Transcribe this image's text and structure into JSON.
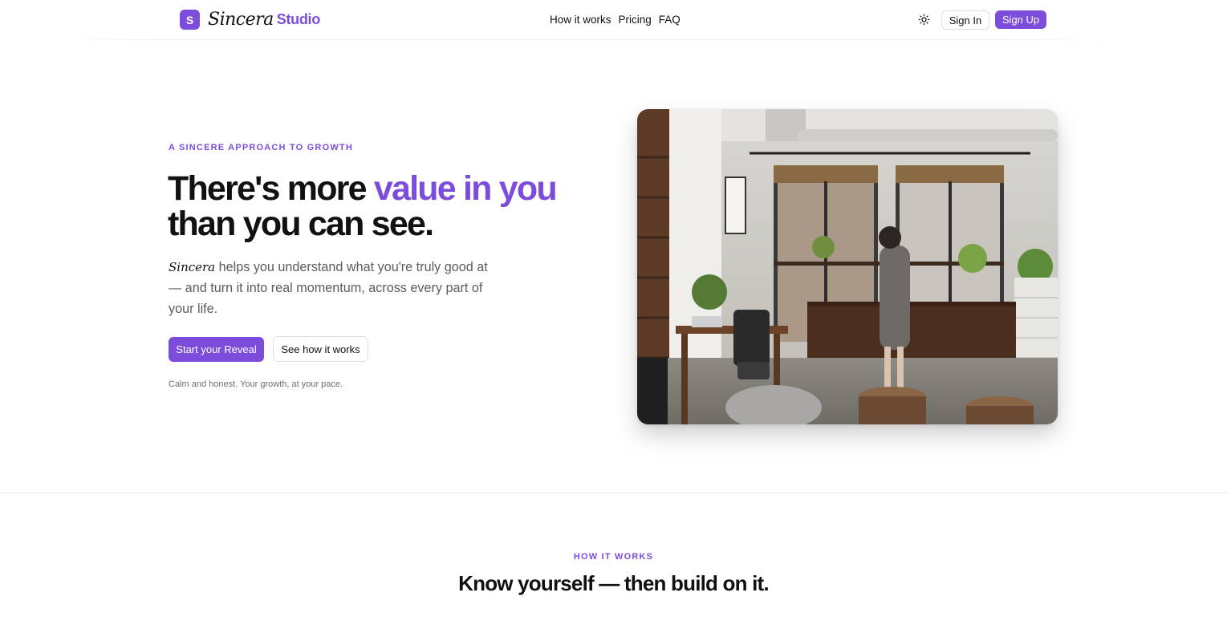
{
  "nav": {
    "logo_letter": "S",
    "logo_script": "Sincera",
    "logo_studio": "Studio",
    "links": [
      "How it works",
      "Pricing",
      "FAQ"
    ],
    "theme_icon": "sun-icon",
    "sign_in": "Sign In",
    "sign_up": "Sign Up"
  },
  "hero": {
    "eyebrow": "A SINCERE APPROACH TO GROWTH",
    "headline_start": "There's more ",
    "headline_accent": "value in you",
    "headline_end": "than you can see.",
    "lede_brand": "Sincera",
    "lede_text": " helps you understand what you're truly good at — and turn it into real momentum, across every part of your life.",
    "cta_primary": "Start your Reveal",
    "cta_secondary": "See how it works",
    "fineprint": "Calm and honest. Your growth, at your pace."
  },
  "section": {
    "eyebrow": "HOW IT WORKS",
    "title": "Know yourself — then build on it."
  },
  "colors": {
    "accent": "#7c4ddb",
    "text": "#111111",
    "muted": "#5a5a63"
  }
}
